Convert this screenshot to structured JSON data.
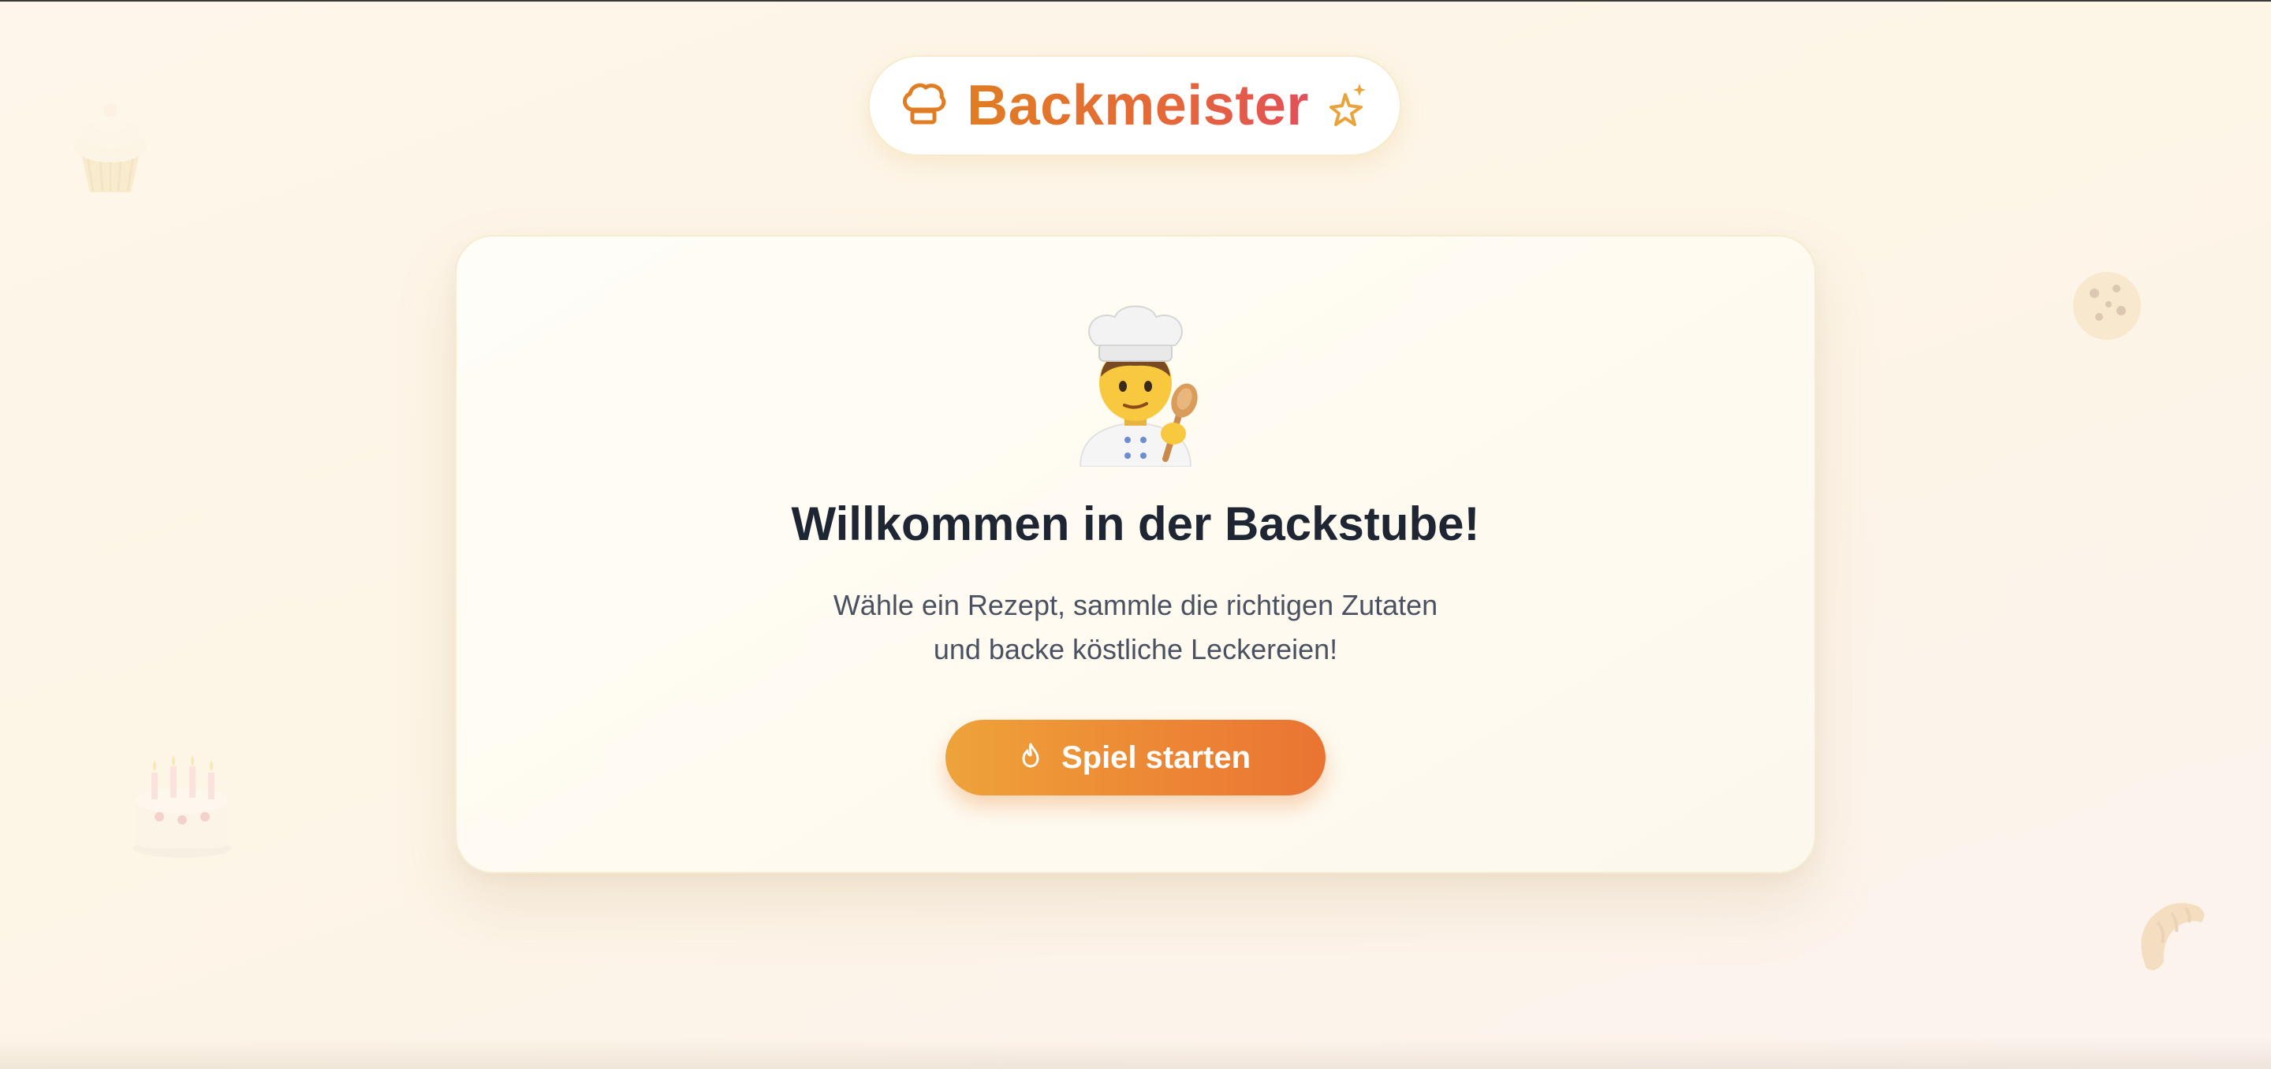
{
  "brand": {
    "title": "Backmeister",
    "leading_icon": "chef-hat-icon",
    "trailing_icon": "sparkles-icon"
  },
  "hero": {
    "mascot": "chef-emoji",
    "headline": "Willkommen in der Backstube!",
    "subtitle_line1": "Wähle ein Rezept, sammle die richtigen Zutaten",
    "subtitle_line2": "und backe köstliche Leckereien!"
  },
  "start_button": {
    "label": "Spiel starten",
    "icon": "flame-icon"
  },
  "decorations": [
    "cupcake-icon",
    "cookie-icon",
    "birthday-cake-icon",
    "croissant-icon"
  ],
  "colors": {
    "accent_orange": "#ea7433",
    "accent_amber": "#eea33a",
    "brand_red": "#e34f58",
    "headline": "#1f2633",
    "body_text": "#4a5262",
    "background": "#fdf6ea"
  }
}
